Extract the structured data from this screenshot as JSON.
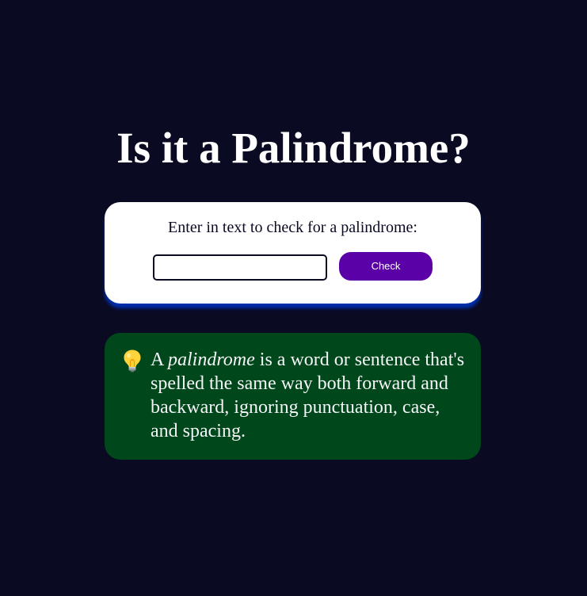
{
  "page": {
    "title": "Is it a Palindrome?"
  },
  "checker": {
    "label": "Enter in text to check for a palindrome:",
    "input_value": "",
    "input_placeholder": "",
    "button_label": "Check"
  },
  "info": {
    "icon": "lightbulb-icon",
    "text_lead": "A ",
    "text_emphasis": "palindrome",
    "text_rest": " is a word or sentence that's spelled the same way both forward and backward, ignoring punctuation, case, and spacing."
  },
  "colors": {
    "background": "#0a0a23",
    "card": "#ffffff",
    "card_shadow": "#002ead",
    "button": "#5a01a7",
    "info_card": "#00471b",
    "text_light": "#f5f6f7"
  }
}
